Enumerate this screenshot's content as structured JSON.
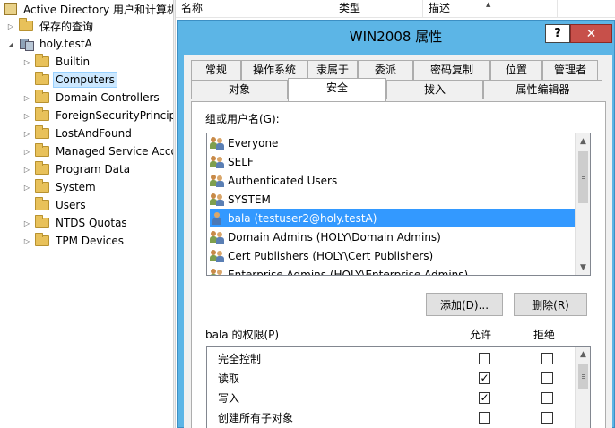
{
  "tree": {
    "items": [
      {
        "label": "Active Directory 用户和计算机",
        "arrow": "",
        "icon": "ad"
      },
      {
        "label": "保存的查询",
        "arrow": "▷",
        "icon": "folder"
      },
      {
        "label": "holy.testA",
        "arrow": "◢",
        "icon": "domain"
      },
      {
        "label": "Builtin",
        "arrow": "▷",
        "icon": "folder"
      },
      {
        "label": "Computers",
        "arrow": "",
        "icon": "folder",
        "selected": true
      },
      {
        "label": "Domain Controllers",
        "arrow": "▷",
        "icon": "folder"
      },
      {
        "label": "ForeignSecurityPrincipals",
        "arrow": "▷",
        "icon": "folder"
      },
      {
        "label": "LostAndFound",
        "arrow": "▷",
        "icon": "folder"
      },
      {
        "label": "Managed Service Accounts",
        "arrow": "▷",
        "icon": "folder"
      },
      {
        "label": "Program Data",
        "arrow": "▷",
        "icon": "folder"
      },
      {
        "label": "System",
        "arrow": "▷",
        "icon": "folder"
      },
      {
        "label": "Users",
        "arrow": "",
        "icon": "folder"
      },
      {
        "label": "NTDS Quotas",
        "arrow": "▷",
        "icon": "folder"
      },
      {
        "label": "TPM Devices",
        "arrow": "▷",
        "icon": "folder"
      }
    ]
  },
  "list": {
    "columns": [
      "名称",
      "类型",
      "描述"
    ]
  },
  "dialog": {
    "title": "WIN2008 属性",
    "help_label": "?",
    "close_label": "✕",
    "tabs_row1": [
      "常规",
      "操作系统",
      "隶属于",
      "委派",
      "密码复制",
      "位置",
      "管理者"
    ],
    "tabs_row2": [
      "对象",
      "安全",
      "拨入",
      "属性编辑器"
    ],
    "active_tab": "安全",
    "users_label": "组或用户名(G):",
    "users": [
      {
        "name": "Everyone",
        "icon": "group"
      },
      {
        "name": "SELF",
        "icon": "group"
      },
      {
        "name": "Authenticated Users",
        "icon": "group"
      },
      {
        "name": "SYSTEM",
        "icon": "group"
      },
      {
        "name": "bala (testuser2@holy.testA)",
        "icon": "user",
        "selected": true
      },
      {
        "name": "Domain Admins (HOLY\\Domain Admins)",
        "icon": "group"
      },
      {
        "name": "Cert Publishers (HOLY\\Cert Publishers)",
        "icon": "group"
      },
      {
        "name": "Enterprise Admins (HOLY\\Enterprise Admins)",
        "icon": "group"
      }
    ],
    "add_button": "添加(D)...",
    "remove_button": "删除(R)",
    "perm_label": "bala 的权限(P)",
    "allow_label": "允许",
    "deny_label": "拒绝",
    "permissions": [
      {
        "name": "完全控制",
        "allow": false,
        "deny": false
      },
      {
        "name": "读取",
        "allow": true,
        "deny": false
      },
      {
        "name": "写入",
        "allow": true,
        "deny": false
      },
      {
        "name": "创建所有子对象",
        "allow": false,
        "deny": false
      }
    ]
  },
  "colors": {
    "titlebar": "#5cb5e6",
    "close": "#c7504a",
    "selection": "#3399ff"
  }
}
